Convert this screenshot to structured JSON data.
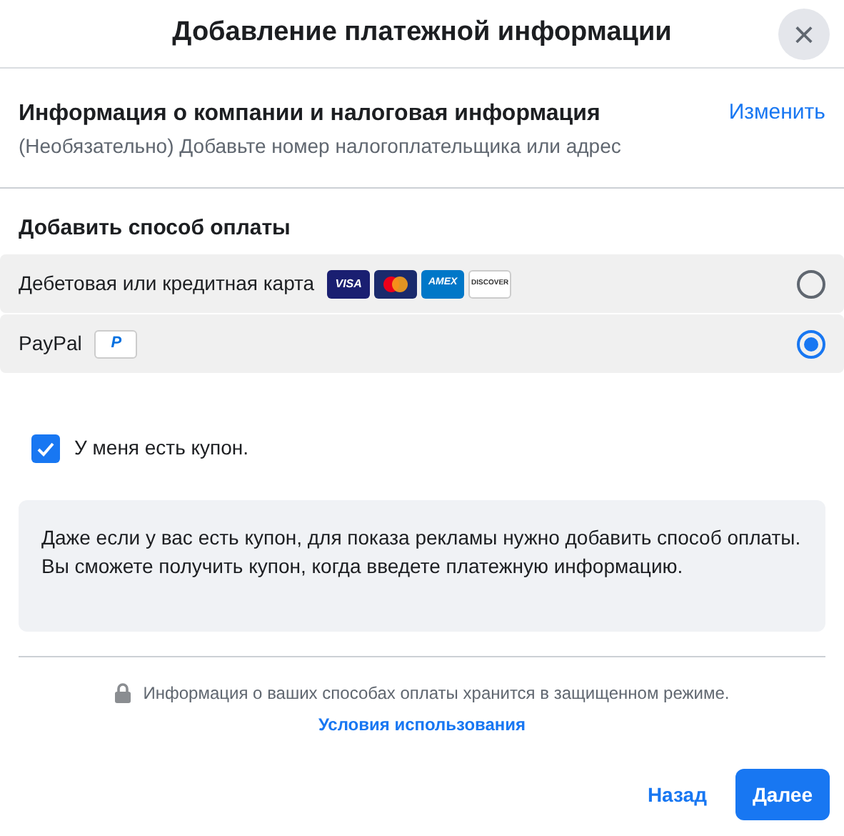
{
  "dialog": {
    "title": "Добавление платежной информации",
    "close_label": "×"
  },
  "company": {
    "title": "Информация о компании и налоговая информация",
    "subtitle": "(Необязательно) Добавьте номер налогоплательщика или адрес",
    "edit_link": "Изменить"
  },
  "payment": {
    "heading": "Добавить способ оплаты",
    "methods": [
      {
        "label": "Дебетовая или кредитная карта",
        "selected": false,
        "logos": [
          {
            "kind": "visa",
            "text": "VISA"
          },
          {
            "kind": "mastercard"
          },
          {
            "kind": "amex",
            "text": "AMEX"
          },
          {
            "kind": "discover",
            "text": "DISCOVER"
          }
        ]
      },
      {
        "label": "PayPal",
        "selected": true,
        "logos": [
          {
            "kind": "paypal",
            "text": "P"
          }
        ]
      }
    ]
  },
  "coupon": {
    "label": "У меня есть купон.",
    "checked": true
  },
  "notice": "Даже если у вас есть купон, для показа рекламы нужно добавить способ оплаты. Вы сможете получить купон, когда введете платежную информацию.",
  "security": {
    "text": "Информация о ваших способах оплаты хранится в защищенном режиме.",
    "terms_link": "Условия использования"
  },
  "buttons": {
    "back": "Назад",
    "next": "Далее"
  }
}
